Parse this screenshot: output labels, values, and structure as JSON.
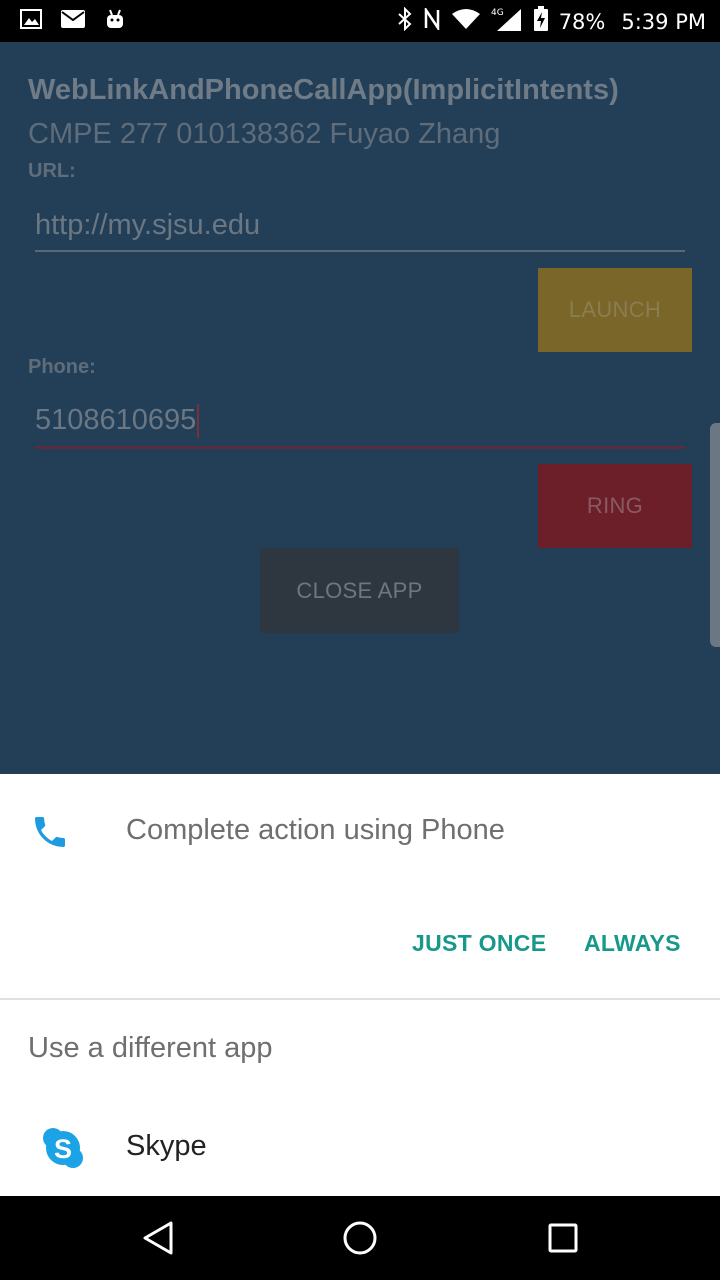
{
  "status_bar": {
    "battery": "78%",
    "time": "5:39 PM",
    "network": "4G"
  },
  "app": {
    "title": "WebLinkAndPhoneCallApp(ImplicitIntents)",
    "subtitle": "CMPE 277 010138362 Fuyao Zhang",
    "url_label": "URL:",
    "url_value": "http://my.sjsu.edu",
    "launch_label": "LAUNCH",
    "phone_label": "Phone:",
    "phone_value": "5108610695",
    "ring_label": "RING",
    "close_label": "CLOSE APP"
  },
  "dialog": {
    "title": "Complete action using Phone",
    "just_once": "JUST ONCE",
    "always": "ALWAYS",
    "different_app": "Use a different app",
    "apps": [
      {
        "label": "Skype",
        "icon": "skype-icon"
      }
    ]
  },
  "colors": {
    "app_background": "#223f57",
    "launch_button": "#7a6628",
    "ring_button": "#6c1f28",
    "close_button": "#2e3640",
    "accent_teal": "#16988a",
    "phone_icon": "#1e9be0",
    "skype_icon": "#1ba3e6"
  }
}
